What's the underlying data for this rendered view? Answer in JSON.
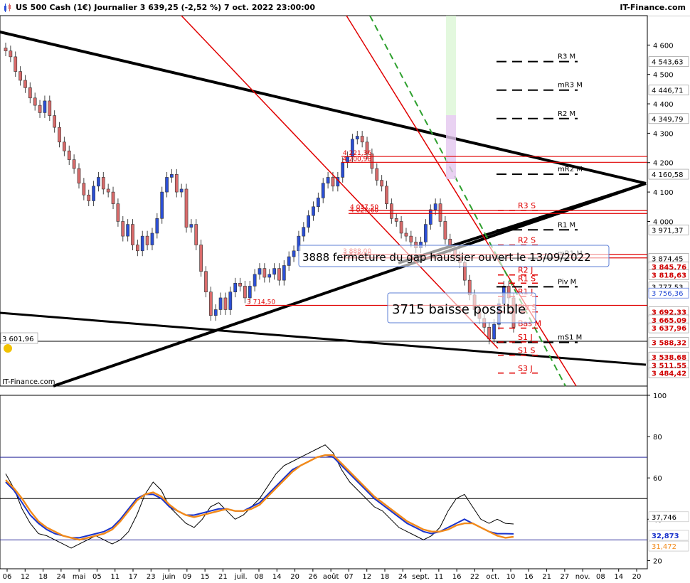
{
  "header": {
    "title": "US 500 Cash (1€) Journalier 3 639,25 (-2,52 %) 7 oct. 2022 23:00:00",
    "brand": "IT-Finance.com"
  },
  "watermark": "IT-Finance.com",
  "price_axis": {
    "ticks": [
      "4 600",
      "4 500",
      "4 400",
      "4 300",
      "4 200",
      "4 100",
      "4 000"
    ],
    "tick_values": [
      4600,
      4500,
      4400,
      4300,
      4200,
      4100,
      4000
    ],
    "ylim": [
      3440,
      4700
    ]
  },
  "osc_axis": {
    "ticks": [
      "100",
      "80",
      "60",
      "40",
      "20"
    ],
    "tick_values": [
      100,
      80,
      60,
      40,
      20
    ],
    "ylim": [
      16,
      100
    ]
  },
  "x_axis": {
    "labels": [
      "06",
      "12",
      "18",
      "24",
      "mai",
      "05",
      "11",
      "17",
      "23",
      "juin",
      "09",
      "15",
      "21",
      "juil.",
      "08",
      "14",
      "20",
      "26",
      "août",
      "07",
      "12",
      "18",
      "24",
      "sept.",
      "11",
      "16",
      "22",
      "oct.",
      "10",
      "16",
      "21",
      "27",
      "nov.",
      "08",
      "14",
      "20"
    ]
  },
  "price_labels": [
    {
      "text": "4 543,63",
      "value": 4543.63,
      "style": "box"
    },
    {
      "text": "4 446,71",
      "value": 4446.71,
      "style": "box"
    },
    {
      "text": "4 349,79",
      "value": 4349.79,
      "style": "box"
    },
    {
      "text": "4 160,58",
      "value": 4160.58,
      "style": "box"
    },
    {
      "text": "3 971,37",
      "value": 3971.37,
      "style": "box"
    },
    {
      "text": "3 874,45",
      "value": 3874.45,
      "style": "box"
    },
    {
      "text": "3 845,76",
      "value": 3845.76,
      "style": "red"
    },
    {
      "text": "3 818,63",
      "value": 3818.63,
      "style": "red"
    },
    {
      "text": "3 777,53",
      "value": 3777.53,
      "style": "box"
    },
    {
      "text": "3 756,36",
      "value": 3756.36,
      "style": "blue"
    },
    {
      "text": "3 692,33",
      "value": 3692.33,
      "style": "red"
    },
    {
      "text": "3 665,09",
      "value": 3665.09,
      "style": "red"
    },
    {
      "text": "3 637,96",
      "value": 3637.96,
      "style": "red"
    },
    {
      "text": "3 588,32",
      "value": 3588.32,
      "style": "red"
    },
    {
      "text": "3 538,68",
      "value": 3538.68,
      "style": "red"
    },
    {
      "text": "3 511,55",
      "value": 3511.55,
      "style": "red"
    },
    {
      "text": "3 484,42",
      "value": 3484.42,
      "style": "red"
    }
  ],
  "left_label": "3 601,96",
  "pivots": [
    {
      "text": "R3 M",
      "value": 4543.63
    },
    {
      "text": "mR3 M",
      "value": 4446.71
    },
    {
      "text": "R2 M",
      "value": 4349.79
    },
    {
      "text": "mR2 M",
      "value": 4160.58
    },
    {
      "text": "R1 M",
      "value": 3971.37
    },
    {
      "text": "mR1 M",
      "value": 3874.45
    },
    {
      "text": "Piv M",
      "value": 3777.53
    },
    {
      "text": "mS1 M",
      "value": 3588.32
    }
  ],
  "red_pivots": [
    {
      "text": "R3 S",
      "value": 4037
    },
    {
      "text": "R2 S",
      "value": 3920
    },
    {
      "text": "R1 S",
      "value": 3790
    },
    {
      "text": "R2 J",
      "value": 3818
    },
    {
      "text": "R1 J",
      "value": 3745
    },
    {
      "text": "Piv S",
      "value": 3692
    },
    {
      "text": "Bas M",
      "value": 3637
    },
    {
      "text": "S1 J",
      "value": 3590
    },
    {
      "text": "S1 S",
      "value": 3545
    },
    {
      "text": "S3 J",
      "value": 3484
    }
  ],
  "hlines": [
    {
      "text": "4 221,36",
      "value": 4221
    },
    {
      "text": "4 200,98",
      "value": 4201
    },
    {
      "text": "4 037,50",
      "value": 4037
    },
    {
      "text": "4 027,60",
      "value": 4027
    },
    {
      "text": "3 888,00",
      "value": 3888
    },
    {
      "text": "3 876,40",
      "value": 3876
    },
    {
      "text": "3 714,50",
      "value": 3714.5
    }
  ],
  "annotations": [
    {
      "text": "3888 fermeture du gap haussier ouvert le 13/09/2022"
    },
    {
      "text": "3715 baisse possible"
    }
  ],
  "osc_labels": [
    {
      "text": "37,746",
      "value": 37.746,
      "color": "#000000"
    },
    {
      "text": "32,873",
      "value": 32.873,
      "color": "#1a33cc"
    },
    {
      "text": "31,472",
      "value": 31.472,
      "color": "#f28a1a"
    }
  ],
  "colors": {
    "bull": "#2b4fd6",
    "bear": "#d96b6b",
    "trend": "#000000",
    "red_line": "#e00000",
    "green_dash": "#2ea02e",
    "osc_fast": "#1a33cc",
    "osc_slow": "#f28a1a"
  },
  "chart_data": [
    {
      "type": "candlestick",
      "title": "US 500 Cash (1€) Journalier",
      "last": 3639.25,
      "change_pct": -2.52,
      "series": [
        {
          "name": "US 500 Cash",
          "close": [
            4580,
            4560,
            4510,
            4480,
            4455,
            4420,
            4395,
            4370,
            4410,
            4360,
            4320,
            4270,
            4240,
            4210,
            4180,
            4130,
            4090,
            4070,
            4120,
            4150,
            4110,
            4100,
            4060,
            4000,
            3950,
            3990,
            3920,
            3900,
            3950,
            3920,
            3960,
            4010,
            4100,
            4150,
            4160,
            4100,
            4110,
            3980,
            3990,
            3920,
            3830,
            3760,
            3680,
            3700,
            3740,
            3700,
            3760,
            3790,
            3780,
            3740,
            3780,
            3820,
            3840,
            3810,
            3820,
            3840,
            3800,
            3850,
            3880,
            3900,
            3950,
            3980,
            4020,
            4050,
            4080,
            4130,
            4150,
            4120,
            4150,
            4200,
            4220,
            4280,
            4290,
            4270,
            4230,
            4180,
            4140,
            4120,
            4060,
            4010,
            4000,
            3960,
            3950,
            3930,
            3910,
            3930,
            3990,
            4040,
            4060,
            4000,
            3940,
            3910,
            3880,
            3860,
            3800,
            3750,
            3700,
            3670,
            3640,
            3600,
            3650,
            3720,
            3780,
            3740,
            3640
          ]
        }
      ]
    },
    {
      "type": "line",
      "title": "",
      "ylim": [
        16,
        100
      ],
      "series": [
        {
          "name": "",
          "values": [
            62,
            55,
            45,
            38,
            33,
            32,
            30,
            28,
            26,
            28,
            30,
            32,
            30,
            28,
            30,
            34,
            42,
            52,
            58,
            54,
            46,
            42,
            38,
            36,
            40,
            46,
            48,
            44,
            40,
            42,
            46,
            50,
            56,
            62,
            66,
            68,
            70,
            72,
            74,
            76,
            72,
            64,
            58,
            54,
            50,
            46,
            44,
            40,
            36,
            34,
            32,
            30,
            32,
            36,
            44,
            50,
            52,
            46,
            40,
            38,
            40,
            38,
            37.7
          ]
        },
        {
          "name": "",
          "values": [
            58,
            54,
            48,
            42,
            38,
            35,
            33,
            32,
            31,
            31,
            32,
            33,
            34,
            36,
            40,
            45,
            50,
            52,
            52,
            50,
            46,
            44,
            42,
            42,
            43,
            44,
            45,
            45,
            44,
            44,
            46,
            48,
            52,
            56,
            60,
            64,
            66,
            68,
            70,
            71,
            70,
            66,
            62,
            58,
            54,
            50,
            47,
            44,
            41,
            38,
            36,
            34,
            33,
            34,
            36,
            38,
            40,
            38,
            36,
            34,
            33,
            33,
            32.9
          ]
        },
        {
          "name": "",
          "values": [
            59,
            55,
            50,
            44,
            39,
            36,
            34,
            32,
            31,
            30,
            31,
            32,
            33,
            35,
            39,
            44,
            49,
            52,
            53,
            51,
            47,
            44,
            42,
            41,
            42,
            43,
            44,
            45,
            44,
            44,
            45,
            47,
            51,
            55,
            59,
            63,
            66,
            68,
            70,
            71,
            71,
            67,
            63,
            59,
            55,
            51,
            48,
            45,
            42,
            39,
            37,
            35,
            34,
            34,
            35,
            37,
            38,
            38,
            36,
            34,
            32,
            31,
            31.5
          ]
        }
      ]
    }
  ]
}
